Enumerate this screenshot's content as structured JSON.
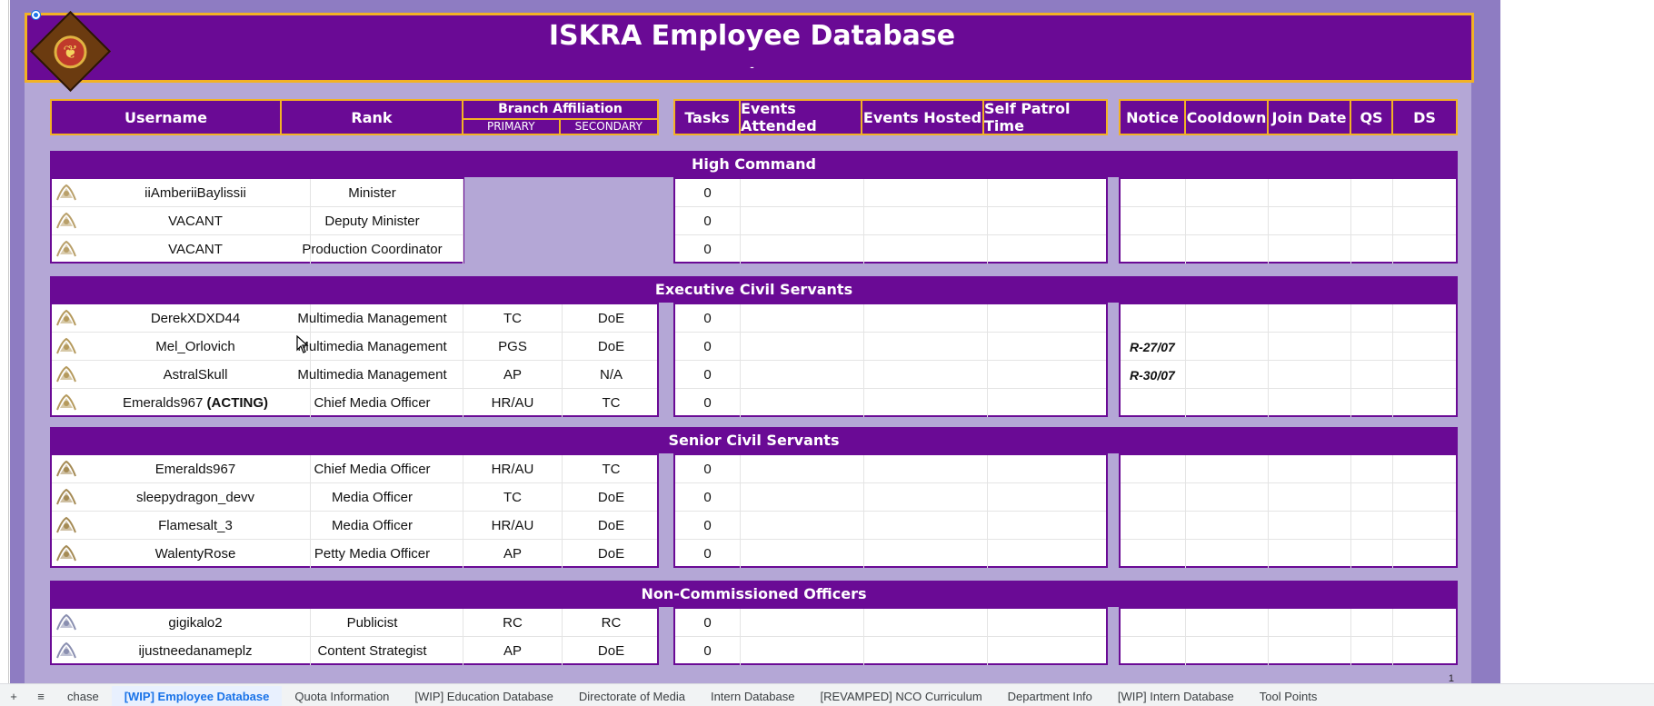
{
  "title": "ISKRA Employee Database",
  "subtitle": "-",
  "columns": {
    "username": "Username",
    "rank": "Rank",
    "branch": "Branch Affiliation",
    "primary": "PRIMARY",
    "secondary": "SECONDARY",
    "tasks": "Tasks",
    "events_attended": "Events Attended",
    "events_hosted": "Events Hosted",
    "self_patrol": "Self Patrol Time",
    "notice": "Notice",
    "cooldown": "Cooldown",
    "join_date": "Join Date",
    "qs": "QS",
    "ds": "DS"
  },
  "sections": [
    {
      "name": "High Command",
      "rows": [
        {
          "username": "iiAmberiiBaylissii",
          "rank": "Minister",
          "primary": "",
          "secondary": "",
          "tasks": "0",
          "notice": ""
        },
        {
          "username": "VACANT",
          "rank": "Deputy Minister",
          "primary": "",
          "secondary": "",
          "tasks": "0",
          "notice": ""
        },
        {
          "username": "VACANT",
          "rank": "Production Coordinator",
          "primary": "",
          "secondary": "",
          "tasks": "0",
          "notice": ""
        }
      ]
    },
    {
      "name": "Executive Civil Servants",
      "rows": [
        {
          "username": "DerekXDXD44",
          "rank": "Multimedia Management",
          "primary": "TC",
          "secondary": "DoE",
          "tasks": "0",
          "notice": ""
        },
        {
          "username": "Mel_Orlovich",
          "rank": "Multimedia Management",
          "primary": "PGS",
          "secondary": "DoE",
          "tasks": "0",
          "notice": "R-27/07"
        },
        {
          "username": "AstralSkull",
          "rank": "Multimedia Management",
          "primary": "AP",
          "secondary": "N/A",
          "tasks": "0",
          "notice": "R-30/07"
        },
        {
          "username": "Emeralds967",
          "username_suffix": "(ACTING)",
          "rank": "Chief Media Officer",
          "primary": "HR/AU",
          "secondary": "TC",
          "tasks": "0",
          "notice": ""
        }
      ]
    },
    {
      "name": "Senior Civil Servants",
      "rows": [
        {
          "username": "Emeralds967",
          "rank": "Chief Media Officer",
          "primary": "HR/AU",
          "secondary": "TC",
          "tasks": "0",
          "notice": ""
        },
        {
          "username": "sleepydragon_devv",
          "rank": "Media Officer",
          "primary": "TC",
          "secondary": "DoE",
          "tasks": "0",
          "notice": ""
        },
        {
          "username": "Flamesalt_3",
          "rank": "Media Officer",
          "primary": "HR/AU",
          "secondary": "DoE",
          "tasks": "0",
          "notice": ""
        },
        {
          "username": "WalentyRose",
          "rank": "Petty Media Officer",
          "primary": "AP",
          "secondary": "DoE",
          "tasks": "0",
          "notice": ""
        }
      ]
    },
    {
      "name": "Non-Commissioned Officers",
      "rows": [
        {
          "username": "gigikalo2",
          "rank": "Publicist",
          "primary": "RC",
          "secondary": "RC",
          "tasks": "0",
          "notice": ""
        },
        {
          "username": "ijustneedanameplz",
          "rank": "Content Strategist",
          "primary": "AP",
          "secondary": "DoE",
          "tasks": "0",
          "notice": ""
        }
      ]
    }
  ],
  "sheet_tabs": [
    "chase",
    "[WIP] Employee Database",
    "Quota Information",
    "[WIP] Education Database",
    "Directorate of Media",
    "Intern Database",
    "[REVAMPED] NCO Curriculum",
    "Department Info",
    "[WIP] Intern Database",
    "Tool Points"
  ],
  "colors": {
    "purple": "#6a0a95",
    "gold": "#f2b225",
    "lavender": "#b4a7d6",
    "backdrop": "#8e7cc2"
  }
}
